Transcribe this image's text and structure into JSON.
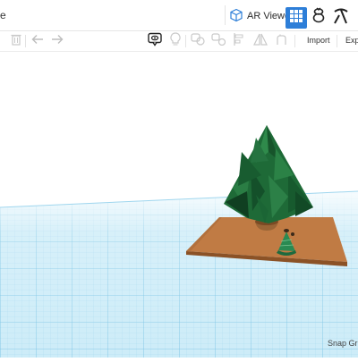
{
  "header": {
    "title_fragment": "e",
    "ar_viewer_label": "AR Viewer"
  },
  "toolbar": {
    "import_label": "Import",
    "export_label": "Expo"
  },
  "footer": {
    "snap_grid_label": "Snap Gri"
  },
  "colors": {
    "grid_blue": "#bfe6f6",
    "grid_line": "#7ec8e8",
    "base_plate": "#b8743f",
    "tree_green": "#1f6b3a",
    "trunk": "#8a5a32",
    "accent": "#2d7ed8"
  }
}
